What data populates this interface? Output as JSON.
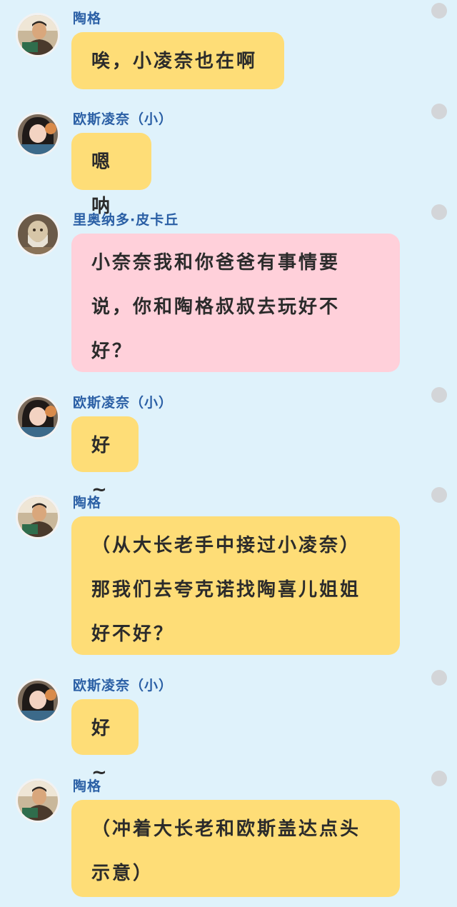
{
  "colors": {
    "background": "#dff2fb",
    "name_text": "#2a5fa5",
    "bubble_yellow": "#fedd77",
    "bubble_pink": "#ffd0da",
    "status_dot": "#d3d5d8"
  },
  "messages": [
    {
      "sender": "陶格",
      "avatar": "avatar-tao-ge",
      "bubble_color": "yellow",
      "text": "唉，小凌奈也在啊"
    },
    {
      "sender": "欧斯凌奈（小）",
      "avatar": "avatar-ling-nai",
      "bubble_color": "yellow",
      "text": "嗯呐"
    },
    {
      "sender": "里奥纳多·皮卡丘",
      "avatar": "avatar-leonardo",
      "bubble_color": "pink",
      "text": "小奈奈我和你爸爸有事情要\n说，你和陶格叔叔去玩好不\n好？"
    },
    {
      "sender": "欧斯凌奈（小）",
      "avatar": "avatar-ling-nai",
      "bubble_color": "yellow",
      "text": "好~"
    },
    {
      "sender": "陶格",
      "avatar": "avatar-tao-ge",
      "bubble_color": "yellow",
      "text": "（从大长老手中接过小凌奈）\n那我们去夸克诺找陶喜儿姐姐\n好不好？"
    },
    {
      "sender": "欧斯凌奈（小）",
      "avatar": "avatar-ling-nai",
      "bubble_color": "yellow",
      "text": "好~"
    },
    {
      "sender": "陶格",
      "avatar": "avatar-tao-ge",
      "bubble_color": "yellow",
      "text": "（冲着大长老和欧斯盖达点头\n示意）"
    }
  ]
}
